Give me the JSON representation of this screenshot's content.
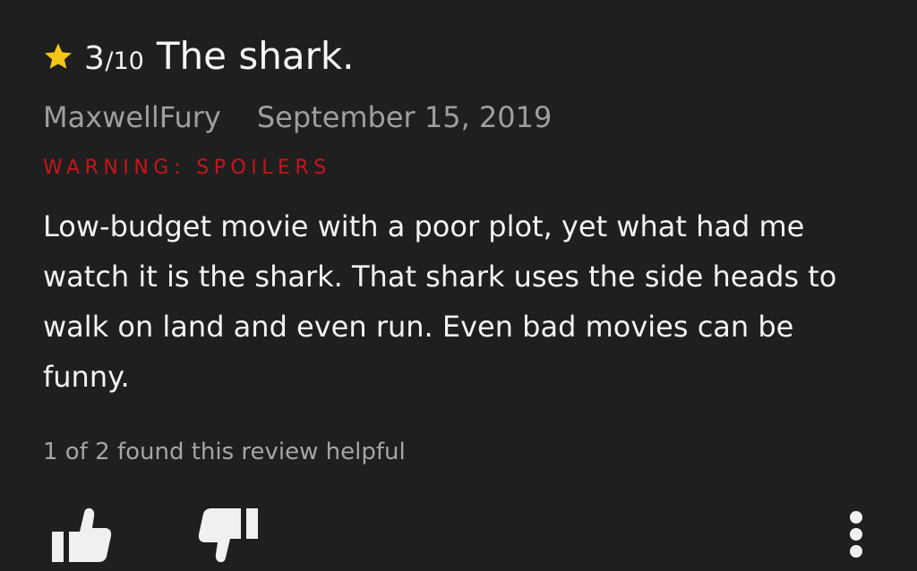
{
  "review": {
    "rating": "3",
    "rating_max": "/10",
    "title": "The shark.",
    "author": "MaxwellFury",
    "date": "September 15, 2019",
    "spoiler_warning": "WARNING: SPOILERS",
    "body": "Low-budget movie with a poor plot, yet what had me watch it is the shark. That shark uses the side heads to walk on land and even run. Even bad movies can be funny.",
    "helpful_text": "1 of 2 found this review helpful"
  },
  "icons": {
    "rating_icon": "star-icon",
    "up_vote_icon": "thumbs-up-icon",
    "down_vote_icon": "thumbs-down-icon",
    "menu_icon": "more-vertical-icon"
  },
  "colors": {
    "background": "#1f1f1f",
    "star": "#f5c518",
    "warning": "#c8151b",
    "meta_text": "#9e9e9e",
    "body_text": "#f3f3f3"
  }
}
